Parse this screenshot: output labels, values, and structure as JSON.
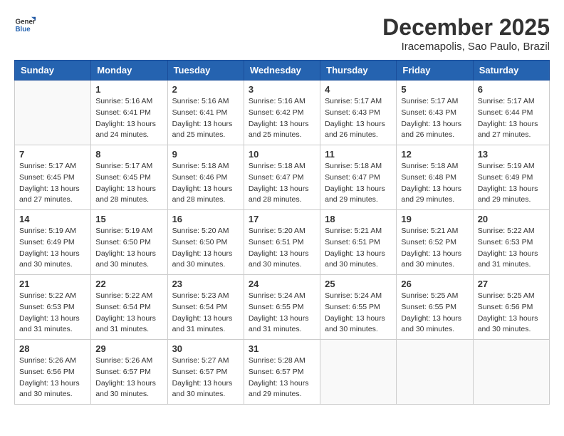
{
  "header": {
    "logo": {
      "general": "General",
      "blue": "Blue"
    },
    "title": "December 2025",
    "location": "Iracemapolis, Sao Paulo, Brazil"
  },
  "weekdays": [
    "Sunday",
    "Monday",
    "Tuesday",
    "Wednesday",
    "Thursday",
    "Friday",
    "Saturday"
  ],
  "weeks": [
    [
      {
        "day": "",
        "sunrise": "",
        "sunset": "",
        "daylight": ""
      },
      {
        "day": "1",
        "sunrise": "Sunrise: 5:16 AM",
        "sunset": "Sunset: 6:41 PM",
        "daylight": "Daylight: 13 hours and 24 minutes."
      },
      {
        "day": "2",
        "sunrise": "Sunrise: 5:16 AM",
        "sunset": "Sunset: 6:41 PM",
        "daylight": "Daylight: 13 hours and 25 minutes."
      },
      {
        "day": "3",
        "sunrise": "Sunrise: 5:16 AM",
        "sunset": "Sunset: 6:42 PM",
        "daylight": "Daylight: 13 hours and 25 minutes."
      },
      {
        "day": "4",
        "sunrise": "Sunrise: 5:17 AM",
        "sunset": "Sunset: 6:43 PM",
        "daylight": "Daylight: 13 hours and 26 minutes."
      },
      {
        "day": "5",
        "sunrise": "Sunrise: 5:17 AM",
        "sunset": "Sunset: 6:43 PM",
        "daylight": "Daylight: 13 hours and 26 minutes."
      },
      {
        "day": "6",
        "sunrise": "Sunrise: 5:17 AM",
        "sunset": "Sunset: 6:44 PM",
        "daylight": "Daylight: 13 hours and 27 minutes."
      }
    ],
    [
      {
        "day": "7",
        "sunrise": "Sunrise: 5:17 AM",
        "sunset": "Sunset: 6:45 PM",
        "daylight": "Daylight: 13 hours and 27 minutes."
      },
      {
        "day": "8",
        "sunrise": "Sunrise: 5:17 AM",
        "sunset": "Sunset: 6:45 PM",
        "daylight": "Daylight: 13 hours and 28 minutes."
      },
      {
        "day": "9",
        "sunrise": "Sunrise: 5:18 AM",
        "sunset": "Sunset: 6:46 PM",
        "daylight": "Daylight: 13 hours and 28 minutes."
      },
      {
        "day": "10",
        "sunrise": "Sunrise: 5:18 AM",
        "sunset": "Sunset: 6:47 PM",
        "daylight": "Daylight: 13 hours and 28 minutes."
      },
      {
        "day": "11",
        "sunrise": "Sunrise: 5:18 AM",
        "sunset": "Sunset: 6:47 PM",
        "daylight": "Daylight: 13 hours and 29 minutes."
      },
      {
        "day": "12",
        "sunrise": "Sunrise: 5:18 AM",
        "sunset": "Sunset: 6:48 PM",
        "daylight": "Daylight: 13 hours and 29 minutes."
      },
      {
        "day": "13",
        "sunrise": "Sunrise: 5:19 AM",
        "sunset": "Sunset: 6:49 PM",
        "daylight": "Daylight: 13 hours and 29 minutes."
      }
    ],
    [
      {
        "day": "14",
        "sunrise": "Sunrise: 5:19 AM",
        "sunset": "Sunset: 6:49 PM",
        "daylight": "Daylight: 13 hours and 30 minutes."
      },
      {
        "day": "15",
        "sunrise": "Sunrise: 5:19 AM",
        "sunset": "Sunset: 6:50 PM",
        "daylight": "Daylight: 13 hours and 30 minutes."
      },
      {
        "day": "16",
        "sunrise": "Sunrise: 5:20 AM",
        "sunset": "Sunset: 6:50 PM",
        "daylight": "Daylight: 13 hours and 30 minutes."
      },
      {
        "day": "17",
        "sunrise": "Sunrise: 5:20 AM",
        "sunset": "Sunset: 6:51 PM",
        "daylight": "Daylight: 13 hours and 30 minutes."
      },
      {
        "day": "18",
        "sunrise": "Sunrise: 5:21 AM",
        "sunset": "Sunset: 6:51 PM",
        "daylight": "Daylight: 13 hours and 30 minutes."
      },
      {
        "day": "19",
        "sunrise": "Sunrise: 5:21 AM",
        "sunset": "Sunset: 6:52 PM",
        "daylight": "Daylight: 13 hours and 30 minutes."
      },
      {
        "day": "20",
        "sunrise": "Sunrise: 5:22 AM",
        "sunset": "Sunset: 6:53 PM",
        "daylight": "Daylight: 13 hours and 31 minutes."
      }
    ],
    [
      {
        "day": "21",
        "sunrise": "Sunrise: 5:22 AM",
        "sunset": "Sunset: 6:53 PM",
        "daylight": "Daylight: 13 hours and 31 minutes."
      },
      {
        "day": "22",
        "sunrise": "Sunrise: 5:22 AM",
        "sunset": "Sunset: 6:54 PM",
        "daylight": "Daylight: 13 hours and 31 minutes."
      },
      {
        "day": "23",
        "sunrise": "Sunrise: 5:23 AM",
        "sunset": "Sunset: 6:54 PM",
        "daylight": "Daylight: 13 hours and 31 minutes."
      },
      {
        "day": "24",
        "sunrise": "Sunrise: 5:24 AM",
        "sunset": "Sunset: 6:55 PM",
        "daylight": "Daylight: 13 hours and 31 minutes."
      },
      {
        "day": "25",
        "sunrise": "Sunrise: 5:24 AM",
        "sunset": "Sunset: 6:55 PM",
        "daylight": "Daylight: 13 hours and 30 minutes."
      },
      {
        "day": "26",
        "sunrise": "Sunrise: 5:25 AM",
        "sunset": "Sunset: 6:55 PM",
        "daylight": "Daylight: 13 hours and 30 minutes."
      },
      {
        "day": "27",
        "sunrise": "Sunrise: 5:25 AM",
        "sunset": "Sunset: 6:56 PM",
        "daylight": "Daylight: 13 hours and 30 minutes."
      }
    ],
    [
      {
        "day": "28",
        "sunrise": "Sunrise: 5:26 AM",
        "sunset": "Sunset: 6:56 PM",
        "daylight": "Daylight: 13 hours and 30 minutes."
      },
      {
        "day": "29",
        "sunrise": "Sunrise: 5:26 AM",
        "sunset": "Sunset: 6:57 PM",
        "daylight": "Daylight: 13 hours and 30 minutes."
      },
      {
        "day": "30",
        "sunrise": "Sunrise: 5:27 AM",
        "sunset": "Sunset: 6:57 PM",
        "daylight": "Daylight: 13 hours and 30 minutes."
      },
      {
        "day": "31",
        "sunrise": "Sunrise: 5:28 AM",
        "sunset": "Sunset: 6:57 PM",
        "daylight": "Daylight: 13 hours and 29 minutes."
      },
      {
        "day": "",
        "sunrise": "",
        "sunset": "",
        "daylight": ""
      },
      {
        "day": "",
        "sunrise": "",
        "sunset": "",
        "daylight": ""
      },
      {
        "day": "",
        "sunrise": "",
        "sunset": "",
        "daylight": ""
      }
    ]
  ]
}
